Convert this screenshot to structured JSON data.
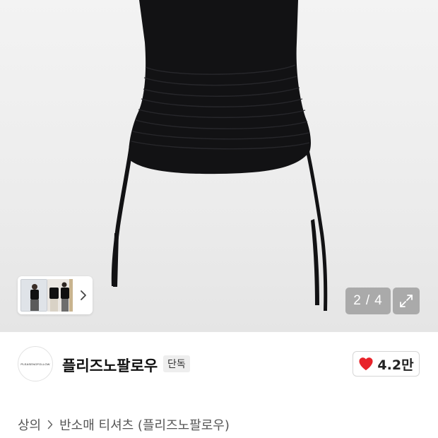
{
  "product_image": {
    "pager": {
      "current": "2",
      "separator": "/",
      "total": "4"
    },
    "thumbnail_icons": [
      "chevron-right-icon"
    ],
    "expand_icon": "expand-icon"
  },
  "brand": {
    "logo_text": "PLEASENOFOLLOW",
    "name": "플리즈노팔로우",
    "badge": "단독"
  },
  "like": {
    "icon": "heart-icon",
    "count": "4.2만",
    "color": "#e8232a"
  },
  "breadcrumb": {
    "category": "상의",
    "subcategory": "반소매 티셔츠 (플리즈노팔로우)"
  },
  "colors": {
    "garment": "#121214",
    "overlay": "#7a7a7a",
    "badge_bg": "#eeeeee"
  }
}
